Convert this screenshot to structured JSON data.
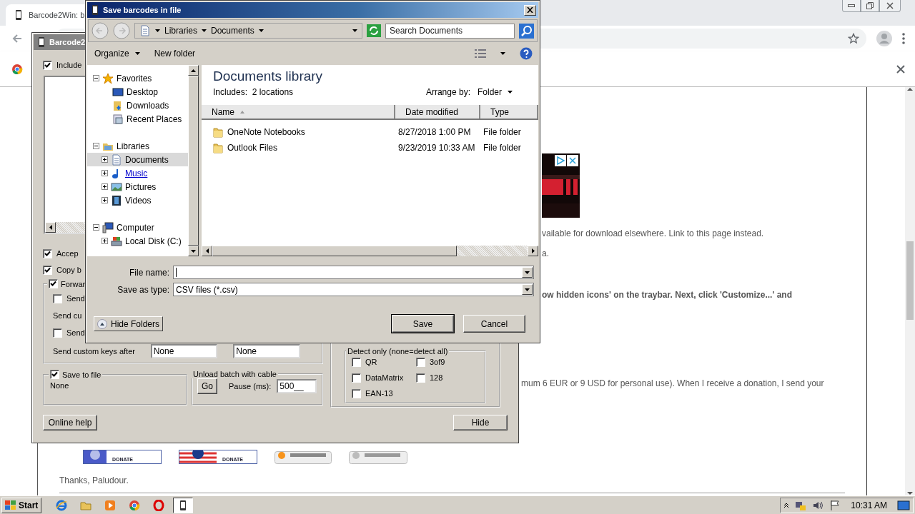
{
  "browser": {
    "tab": {
      "title": "Barcode2Win: b"
    },
    "page": {
      "text_lines": [
        {
          "text": "vailable for download elsewhere. Link to this page instead.",
          "bold": false
        },
        {
          "text": "a.",
          "bold": false
        },
        {
          "text": "ow hidden icons' on the traybar. Next, click 'Customize...' and",
          "bold": true
        },
        {
          "text": "mum 6 EUR or 9 USD for personal use). When I receive a donation, I send your",
          "bold": false
        }
      ],
      "donate_buttons": [
        {
          "kind": "paypal-euro",
          "label": "DONATE"
        },
        {
          "kind": "paypal-dollar",
          "label": "DONATE"
        },
        {
          "kind": "bitcoin"
        },
        {
          "kind": "litecoin"
        }
      ],
      "signature": "Thanks, Paludour."
    }
  },
  "app_window": {
    "title": "Barcode2",
    "options_top": [
      {
        "label": "Include",
        "checked": true
      }
    ],
    "options": [
      {
        "label": "Accep",
        "checked": true
      },
      {
        "label": "Copy b",
        "checked": true
      }
    ],
    "forward": {
      "label": "Forwar",
      "checked": true,
      "items": [
        {
          "kind": "checkbox",
          "label": "Send",
          "checked": false
        },
        {
          "kind": "text",
          "label": "Send cu"
        },
        {
          "kind": "checkbox",
          "label": "Send",
          "checked": false
        }
      ],
      "custom_keys": {
        "label": "Send custom keys after",
        "values": [
          "None",
          "None"
        ]
      }
    },
    "save_to_file": {
      "label": "Save to file",
      "checked": true,
      "path": "None"
    },
    "unload_batch": {
      "title": "Unload batch with cable",
      "button": "Go",
      "pause_label": "Pause (ms):",
      "pause_value": "500__"
    },
    "detect_only": {
      "title": "Detect only (none=detect all)",
      "types": [
        {
          "label": "QR",
          "checked": false
        },
        {
          "label": "3of9",
          "checked": false
        },
        {
          "label": "DataMatrix",
          "checked": false
        },
        {
          "label": "128",
          "checked": false
        },
        {
          "label": "EAN-13",
          "checked": false
        }
      ]
    },
    "buttons": [
      "Online help",
      "Hide"
    ]
  },
  "dialog": {
    "title": "Save barcodes in file",
    "breadcrumb": [
      "Libraries",
      "Documents"
    ],
    "search": {
      "placeholder": "Search Documents"
    },
    "toolbar": {
      "organize": "Organize",
      "new_folder": "New folder"
    },
    "tree": [
      {
        "label": "Favorites",
        "kind": "favorites",
        "expanded": true,
        "selected": false,
        "hovered": false,
        "children": [
          {
            "label": "Desktop",
            "kind": "desktop",
            "selected": false,
            "hovered": false
          },
          {
            "label": "Downloads",
            "kind": "downloads",
            "selected": false,
            "hovered": false
          },
          {
            "label": "Recent Places",
            "kind": "recent",
            "selected": false,
            "hovered": false
          }
        ]
      },
      {
        "label": "Libraries",
        "kind": "libraries",
        "expanded": true,
        "selected": false,
        "hovered": false,
        "children": [
          {
            "label": "Documents",
            "kind": "documents",
            "expanded": false,
            "selected": true,
            "hovered": false
          },
          {
            "label": "Music",
            "kind": "music",
            "expanded": false,
            "selected": false,
            "hovered": true
          },
          {
            "label": "Pictures",
            "kind": "pictures",
            "expanded": false,
            "selected": false,
            "hovered": false
          },
          {
            "label": "Videos",
            "kind": "videos",
            "expanded": false,
            "selected": false,
            "hovered": false
          }
        ]
      },
      {
        "label": "Computer",
        "kind": "computer",
        "expanded": true,
        "selected": false,
        "hovered": false,
        "children": [
          {
            "label": "Local Disk (C:)",
            "kind": "disk",
            "expanded": false,
            "selected": false,
            "hovered": false
          }
        ]
      }
    ],
    "library": {
      "title": "Documents library",
      "includes": "Includes:  2 locations",
      "arrange_label": "Arrange by:",
      "arrange_value": "Folder"
    },
    "columns": [
      {
        "label": "Name",
        "sorted": true
      },
      {
        "label": "Date modified",
        "sorted": false
      },
      {
        "label": "Type",
        "sorted": false
      }
    ],
    "rows": [
      {
        "name": "OneNote Notebooks",
        "date": "8/27/2018 1:00 PM",
        "type": "File folder"
      },
      {
        "name": "Outlook Files",
        "date": "9/23/2019 10:33 AM",
        "type": "File folder"
      }
    ],
    "file_name": {
      "label": "File name:"
    },
    "save_type": {
      "label": "Save as type:",
      "value": "CSV files (*.csv)"
    },
    "hide_folders": "Hide Folders",
    "buttons": [
      {
        "label": "Save",
        "default": true
      },
      {
        "label": "Cancel",
        "default": false
      }
    ]
  },
  "taskbar": {
    "start": "Start",
    "apps": [
      {
        "kind": "ie",
        "selected": false
      },
      {
        "kind": "explorer",
        "selected": false
      },
      {
        "kind": "media",
        "selected": false
      },
      {
        "kind": "chrome",
        "selected": false
      },
      {
        "kind": "opera",
        "selected": false
      },
      {
        "kind": "barcode",
        "selected": true
      }
    ],
    "clock": "10:31 AM"
  }
}
